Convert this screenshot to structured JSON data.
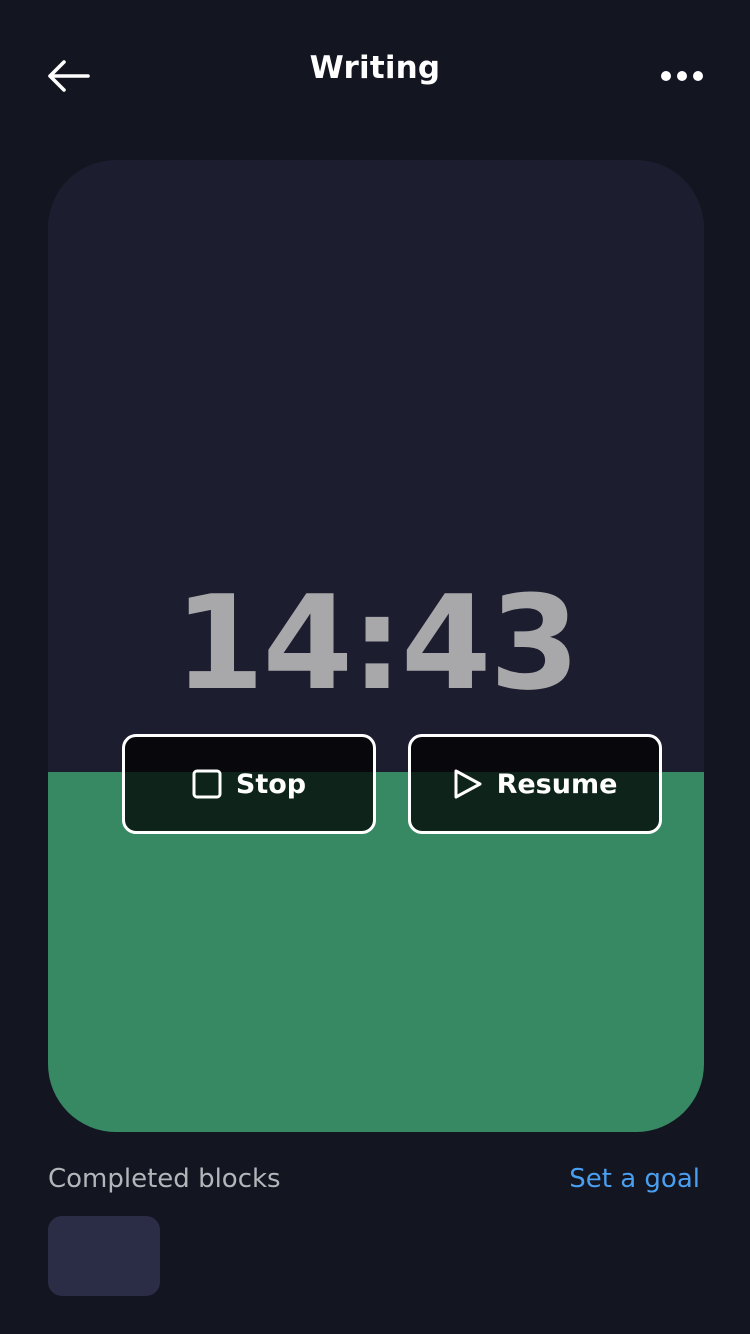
{
  "header": {
    "title": "Writing",
    "back_icon": "arrow-left-icon",
    "more_icon": "more-dots-icon"
  },
  "timer": {
    "time": "14:43",
    "progress_fraction": 0.37,
    "colors": {
      "card_background": "#1c1e30",
      "progress": "#378963"
    }
  },
  "controls": {
    "stop_label": "Stop",
    "stop_icon": "stop-square-icon",
    "resume_label": "Resume",
    "resume_icon": "play-icon"
  },
  "footer": {
    "completed_label": "Completed blocks",
    "goal_link": "Set a goal"
  },
  "colors": {
    "background": "#131520",
    "link": "#4a9ff0",
    "block_tile": "#2b2d47"
  }
}
